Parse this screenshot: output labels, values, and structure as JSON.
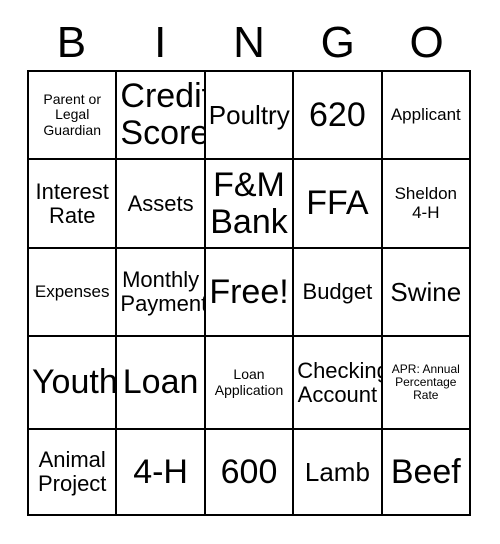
{
  "card": {
    "title_letters": [
      "B",
      "I",
      "N",
      "G",
      "O"
    ],
    "columns": 5,
    "rows": 5,
    "free_space_label": "Free!",
    "border_color": "#000000",
    "background_color": "#ffffff",
    "text_color": "#000000",
    "cells": [
      [
        {
          "text": "Parent or Legal Guardian",
          "size": "xs"
        },
        {
          "text": "Credit Score",
          "size": "xxl"
        },
        {
          "text": "Poultry",
          "size": "lg"
        },
        {
          "text": "620",
          "size": "xxl"
        },
        {
          "text": "Applicant",
          "size": "sm"
        }
      ],
      [
        {
          "text": "Interest Rate",
          "size": "md"
        },
        {
          "text": "Assets",
          "size": "md"
        },
        {
          "text": "F&M Bank",
          "size": "xxl"
        },
        {
          "text": "FFA",
          "size": "xxl"
        },
        {
          "text": "Sheldon 4-H",
          "size": "sm"
        }
      ],
      [
        {
          "text": "Expenses",
          "size": "sm"
        },
        {
          "text": "Monthly Payment",
          "size": "md"
        },
        {
          "text": "Free!",
          "size": "xxl"
        },
        {
          "text": "Budget",
          "size": "md"
        },
        {
          "text": "Swine",
          "size": "lg"
        }
      ],
      [
        {
          "text": "Youth",
          "size": "xxl"
        },
        {
          "text": "Loan",
          "size": "xxl"
        },
        {
          "text": "Loan Application",
          "size": "xs"
        },
        {
          "text": "Checking Account",
          "size": "md"
        },
        {
          "text": "APR: Annual Percentage Rate",
          "size": "xxs"
        }
      ],
      [
        {
          "text": "Animal Project",
          "size": "md"
        },
        {
          "text": "4-H",
          "size": "xxl"
        },
        {
          "text": "600",
          "size": "xxl"
        },
        {
          "text": "Lamb",
          "size": "lg"
        },
        {
          "text": "Beef",
          "size": "xxl"
        }
      ]
    ]
  }
}
